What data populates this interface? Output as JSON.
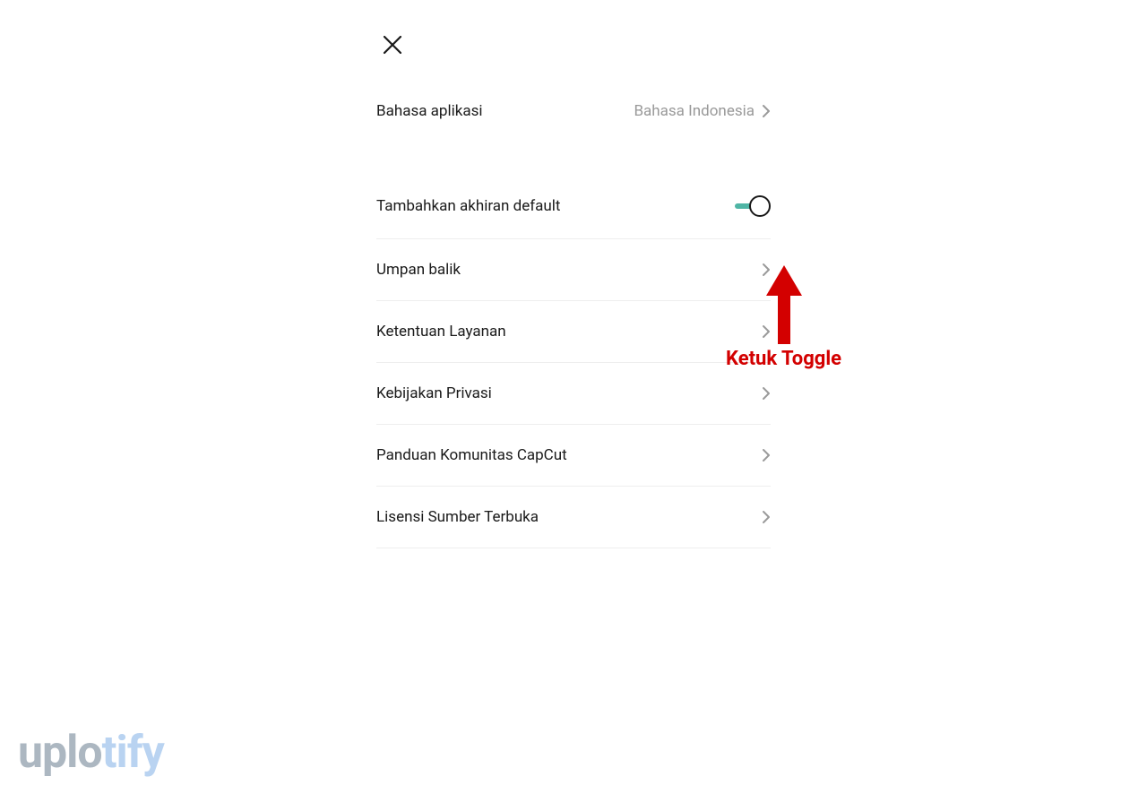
{
  "header": {
    "close_icon": "close"
  },
  "settings": {
    "language": {
      "label": "Bahasa aplikasi",
      "value": "Bahasa Indonesia"
    },
    "default_suffix": {
      "label": "Tambahkan akhiran default",
      "toggle_on": true
    },
    "feedback": {
      "label": "Umpan balik"
    },
    "terms": {
      "label": "Ketentuan Layanan"
    },
    "privacy": {
      "label": "Kebijakan Privasi"
    },
    "community": {
      "label": "Panduan Komunitas CapCut"
    },
    "opensource": {
      "label": "Lisensi Sumber Terbuka"
    }
  },
  "annotation": {
    "text": "Ketuk Toggle"
  },
  "watermark": {
    "part1": "uplo",
    "part2": "tify"
  }
}
